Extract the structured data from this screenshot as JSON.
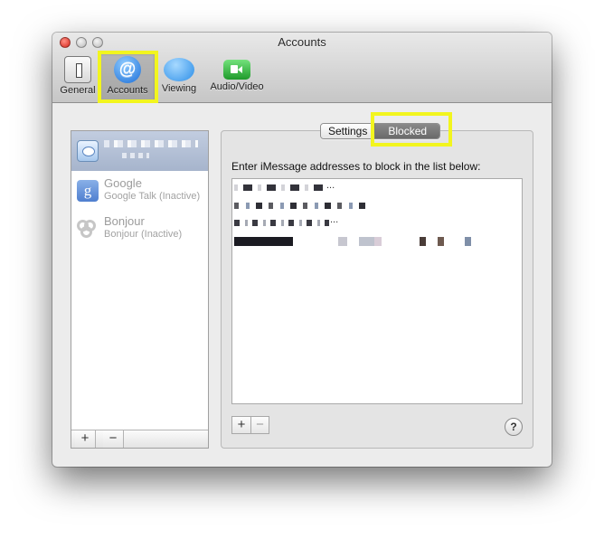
{
  "window": {
    "title": "Accounts"
  },
  "toolbar": {
    "items": [
      {
        "label": "General",
        "icon": "general-switch-icon"
      },
      {
        "label": "Accounts",
        "icon": "at-sign-icon",
        "selected": true
      },
      {
        "label": "Viewing",
        "icon": "speech-bubble-icon"
      },
      {
        "label": "Audio/Video",
        "icon": "video-camera-icon"
      }
    ]
  },
  "accounts": [
    {
      "name": "",
      "status": "",
      "icon": "imessage-icon",
      "selected": true,
      "redacted": true
    },
    {
      "name": "Google",
      "status": "Google Talk (Inactive)",
      "icon": "google-g-icon"
    },
    {
      "name": "Bonjour",
      "status": "Bonjour (Inactive)",
      "icon": "bonjour-icon"
    }
  ],
  "left_buttons": {
    "add": "+",
    "remove": "−"
  },
  "tabs": {
    "settings": "Settings",
    "blocked": "Blocked",
    "active": "Blocked"
  },
  "blocked": {
    "instruction": "Enter iMessage addresses to block in the list below:",
    "ellipsis": "...",
    "add": "+",
    "remove": "−"
  },
  "help": "?",
  "colors": {
    "highlight": "#f2f51e",
    "selected_row": "#b3c0d6",
    "active_tab": "#7a7a7a"
  }
}
